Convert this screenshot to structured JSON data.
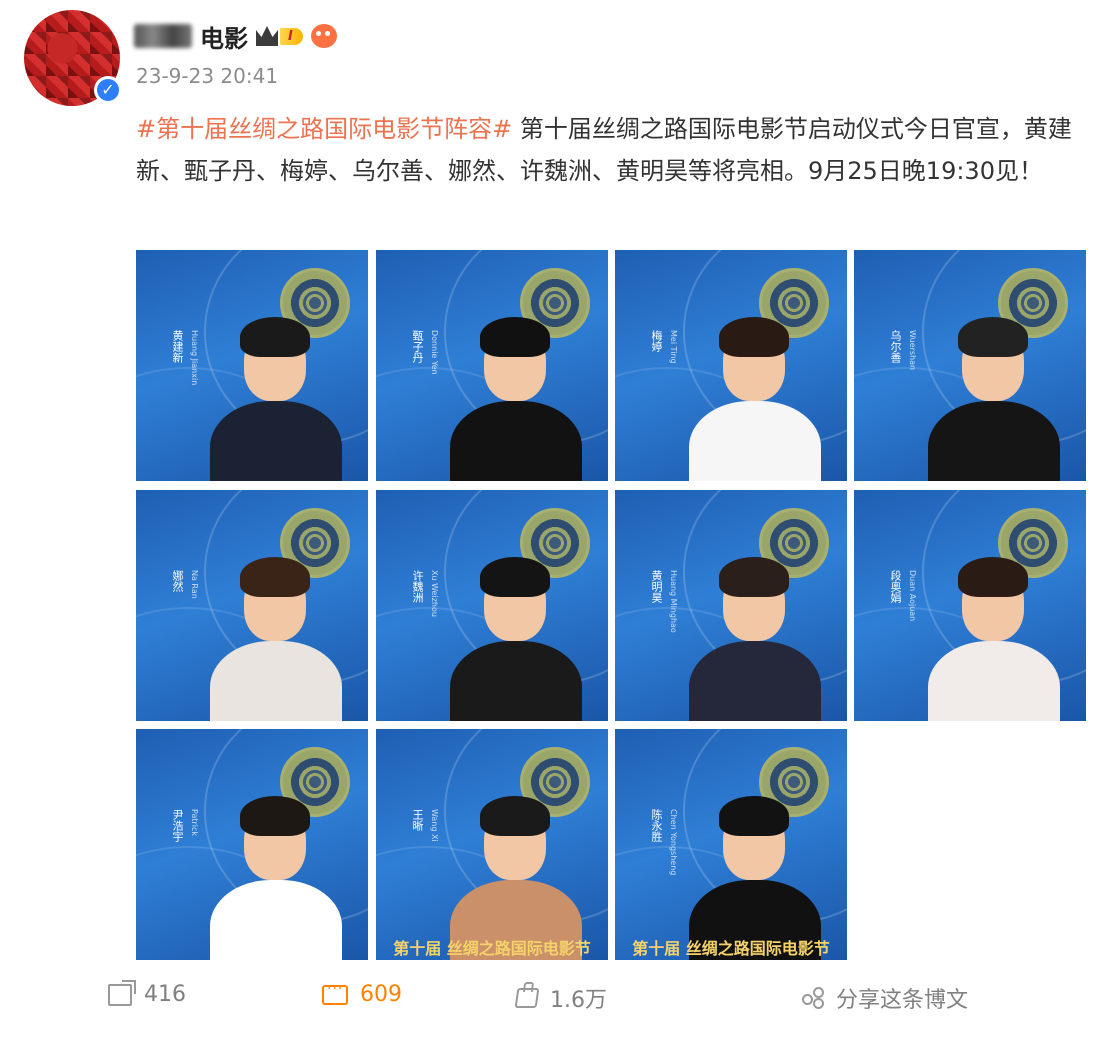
{
  "post": {
    "author_name": "电影",
    "level_badge": "I",
    "time": "23-9-23 20:41",
    "topic": "#第十届丝绸之路国际电影节阵容#",
    "text": " 第十届丝绸之路国际电影节启动仪式今日官宣，黄建新、甄子丹、梅婷、乌尔善、娜然、许魏洲、黄明昊等将亮相。9月25日晚19:30见！"
  },
  "tiles": [
    {
      "name_cn": "黄建新",
      "name_en": "Huang Jianxin",
      "hair": "#1a1a1a",
      "body": "#1b2233"
    },
    {
      "name_cn": "甄子丹",
      "name_en": "Donnie Yen",
      "hair": "#111111",
      "body": "#121212"
    },
    {
      "name_cn": "梅婷",
      "name_en": "Mei Ting",
      "hair": "#2a1a14",
      "body": "#f6f6f6"
    },
    {
      "name_cn": "乌尔善",
      "name_en": "Wuershan",
      "hair": "#222222",
      "body": "#151515"
    },
    {
      "name_cn": "娜然",
      "name_en": "Na Ran",
      "hair": "#3a2418",
      "body": "#e9e4df"
    },
    {
      "name_cn": "许魏洲",
      "name_en": "Xu Weizhou",
      "hair": "#141414",
      "body": "#1a1a1a"
    },
    {
      "name_cn": "黄明昊",
      "name_en": "Huang Minghao",
      "hair": "#2a1f1a",
      "body": "#24283a"
    },
    {
      "name_cn": "段奥娟",
      "name_en": "Duan Aojuan",
      "hair": "#2a1c14",
      "body": "#f1ecea"
    },
    {
      "name_cn": "尹浩宇",
      "name_en": "Patrick",
      "hair": "#1e1815",
      "body": "#ffffff"
    },
    {
      "name_cn": "王晰",
      "name_en": "Wang Xi",
      "hair": "#1a1a1a",
      "body": "#c9906a",
      "banner": "第十届 丝绸之路国际电影节"
    },
    {
      "name_cn": "陈永胜",
      "name_en": "Chen Yongsheng",
      "hair": "#121212",
      "body": "#111111",
      "banner": "第十届 丝绸之路国际电影节"
    }
  ],
  "actions": {
    "share": "416",
    "comment": "609",
    "like": "1.6万",
    "repost_label": "分享这条博文"
  }
}
